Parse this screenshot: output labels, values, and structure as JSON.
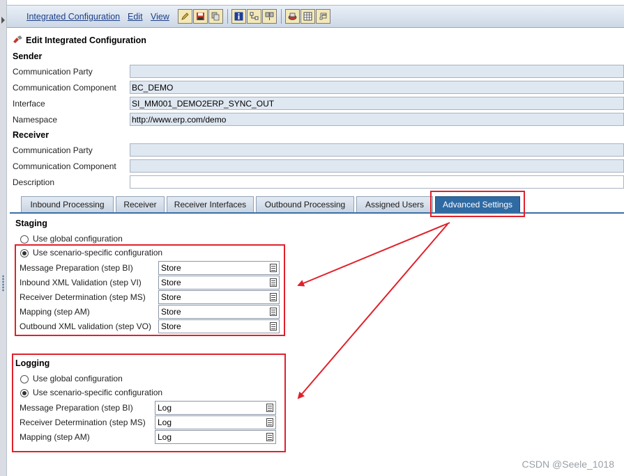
{
  "menu": {
    "integrated_configuration": "Integrated Configuration",
    "edit": "Edit",
    "view": "View"
  },
  "toolbar": {
    "icons": [
      "edit-pencil-icon",
      "save-icon",
      "copy-icon",
      "info-icon",
      "where-used-icon",
      "compare-icon",
      "transport-icon",
      "table-icon",
      "history-icon"
    ]
  },
  "page": {
    "title": "Edit Integrated Configuration"
  },
  "sender": {
    "heading": "Sender",
    "fields": [
      {
        "label": "Communication Party",
        "value": ""
      },
      {
        "label": "Communication Component",
        "value": "BC_DEMO"
      },
      {
        "label": "Interface",
        "value": "SI_MM001_DEMO2ERP_SYNC_OUT"
      },
      {
        "label": "Namespace",
        "value": "http://www.erp.com/demo"
      }
    ]
  },
  "receiver": {
    "heading": "Receiver",
    "fields": [
      {
        "label": "Communication Party",
        "value": ""
      },
      {
        "label": "Communication Component",
        "value": ""
      },
      {
        "label": "Description",
        "value": ""
      }
    ]
  },
  "tabs": [
    "Inbound Processing",
    "Receiver",
    "Receiver Interfaces",
    "Outbound Processing",
    "Assigned Users",
    "Advanced Settings"
  ],
  "active_tab": "Advanced Settings",
  "staging": {
    "heading": "Staging",
    "global_option": "Use global configuration",
    "scenario_option": "Use scenario-specific configuration",
    "selected": "scenario",
    "rows": [
      {
        "label": "Message Preparation (step BI)",
        "value": "Store"
      },
      {
        "label": "Inbound XML Validation (step VI)",
        "value": "Store"
      },
      {
        "label": "Receiver Determination (step MS)",
        "value": "Store"
      },
      {
        "label": "Mapping (step AM)",
        "value": "Store"
      },
      {
        "label": "Outbound XML validation (step VO)",
        "value": "Store"
      }
    ]
  },
  "logging": {
    "heading": "Logging",
    "global_option": "Use global configuration",
    "scenario_option": "Use scenario-specific configuration",
    "selected": "scenario",
    "rows": [
      {
        "label": "Message Preparation (step BI)",
        "value": "Log"
      },
      {
        "label": "Receiver Determination (step MS)",
        "value": "Log"
      },
      {
        "label": "Mapping (step AM)",
        "value": "Log"
      }
    ]
  },
  "colors": {
    "annotation_red": "#e0212b",
    "active_tab_blue": "#2f6aa3",
    "field_bg": "#dfe7f1"
  },
  "watermark": "CSDN @Seele_1018"
}
